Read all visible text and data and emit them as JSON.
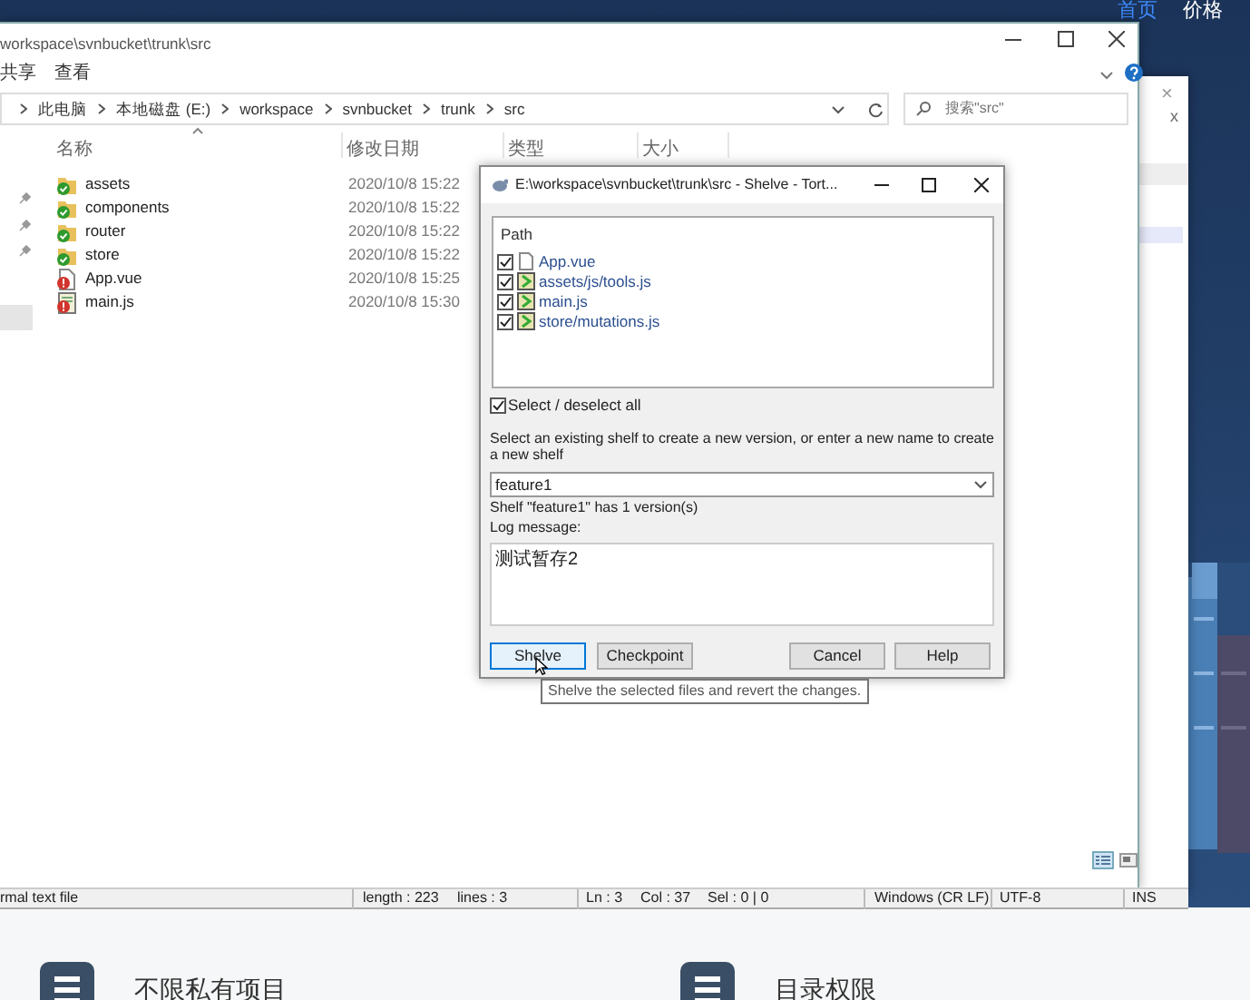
{
  "site_nav": [
    {
      "label": "首页",
      "selected": true
    },
    {
      "label": "价格",
      "selected": false
    }
  ],
  "features": [
    {
      "label": "不限私有项目"
    },
    {
      "label": "目录权限"
    }
  ],
  "back_window": {
    "close": [
      "×",
      "x"
    ]
  },
  "explorer": {
    "title": "workspace\\svnbucket\\trunk\\src",
    "ribbon_tabs": [
      "共享",
      "查看"
    ],
    "breadcrumbs": [
      "此电脑",
      "本地磁盘 (E:)",
      "workspace",
      "svnbucket",
      "trunk",
      "src"
    ],
    "search": {
      "placeholder": "搜索\"src\""
    },
    "columns": [
      "名称",
      "修改日期",
      "类型",
      "大小"
    ],
    "rows": [
      {
        "name": "assets",
        "modified": "2020/10/8 15:22",
        "kind": "folder",
        "changed": false
      },
      {
        "name": "components",
        "modified": "2020/10/8 15:22",
        "kind": "folder",
        "changed": false
      },
      {
        "name": "router",
        "modified": "2020/10/8 15:22",
        "kind": "folder",
        "changed": false
      },
      {
        "name": "store",
        "modified": "2020/10/8 15:22",
        "kind": "folder",
        "changed": false
      },
      {
        "name": "App.vue",
        "modified": "2020/10/8 15:25",
        "kind": "file",
        "changed": true
      },
      {
        "name": "main.js",
        "modified": "2020/10/8 15:30",
        "kind": "script",
        "changed": true
      }
    ]
  },
  "editor_status": [
    "rmal text file",
    "length : 223",
    "lines : 3",
    "Ln : 3",
    "Col : 37",
    "Sel : 0 | 0",
    "Windows (CR LF)",
    "UTF-8",
    "INS"
  ],
  "dialog": {
    "title": "E:\\workspace\\svnbucket\\trunk\\src - Shelve - Tort...",
    "list_header": "Path",
    "files": [
      {
        "path": "App.vue",
        "kind": "file",
        "checked": true
      },
      {
        "path": "assets/js/tools.js",
        "kind": "script",
        "checked": true
      },
      {
        "path": "main.js",
        "kind": "script",
        "checked": true
      },
      {
        "path": "store/mutations.js",
        "kind": "script",
        "checked": true
      }
    ],
    "select_all": {
      "label": "Select / deselect all",
      "checked": true
    },
    "instruction": "Select an existing shelf to create a new version, or enter a new name to create a new shelf",
    "shelf_name": "feature1",
    "shelf_info": "Shelf \"feature1\" has 1 version(s)",
    "log_label": "Log message:",
    "log_message": "测试暂存2",
    "buttons": [
      {
        "label": "Shelve",
        "selected": true
      },
      {
        "label": "Checkpoint",
        "selected": false
      },
      {
        "label": "Cancel",
        "selected": false
      },
      {
        "label": "Help",
        "selected": false
      }
    ],
    "tooltip": "Shelve the selected files and revert the changes."
  }
}
